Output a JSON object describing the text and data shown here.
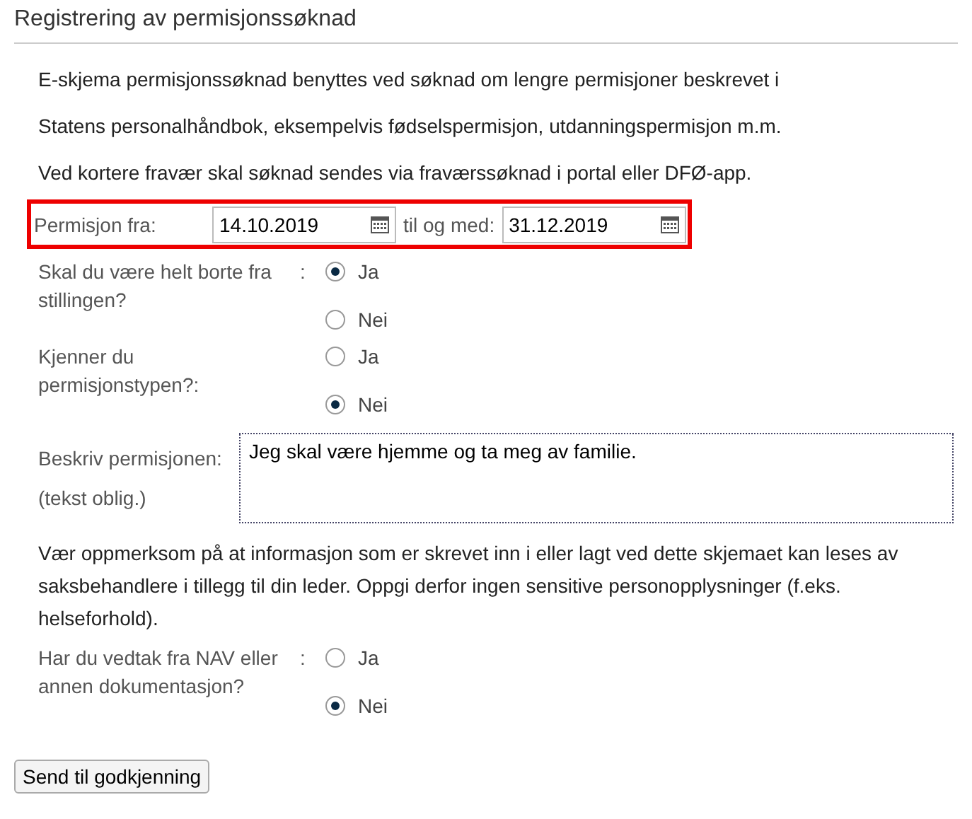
{
  "title": "Registrering av permisjonssøknad",
  "intro": [
    "E-skjema permisjonssøknad benyttes ved søknad om lengre permisjoner beskrevet i",
    "Statens personalhåndbok, eksempelvis fødselspermisjon, utdanningspermisjon m.m.",
    "Ved kortere fravær skal søknad sendes via fraværssøknad i portal eller DFØ-app."
  ],
  "date_range": {
    "label": "Permisjon fra:",
    "from": "14.10.2019",
    "to_label": "til og med:",
    "to": "31.12.2019"
  },
  "questions": [
    {
      "label": "Skal du være helt borte fra stillingen?",
      "separator": ":",
      "options": [
        {
          "label": "Ja",
          "selected": true
        },
        {
          "label": "Nei",
          "selected": false
        }
      ]
    },
    {
      "label": "Kjenner du permisjonstypen?:",
      "options": [
        {
          "label": "Ja",
          "selected": false
        },
        {
          "label": "Nei",
          "selected": true
        }
      ]
    }
  ],
  "description": {
    "label": "Beskriv permisjonen:",
    "note": "(tekst oblig.)",
    "value": "Jeg skal være hjemme og ta meg av familie."
  },
  "notice": "Vær oppmerksom på at informasjon som er skrevet inn i eller lagt ved dette skjemaet kan leses av saksbehandlere i tillegg til din leder. Oppgi derfor ingen sensitive personopplysninger (f.eks. helseforhold).",
  "final_question": {
    "label": "Har du vedtak fra NAV eller annen dokumentasjon?",
    "separator": ":",
    "options": [
      {
        "label": "Ja",
        "selected": false
      },
      {
        "label": "Nei",
        "selected": true
      }
    ]
  },
  "submit_button": "Send til godkjenning"
}
